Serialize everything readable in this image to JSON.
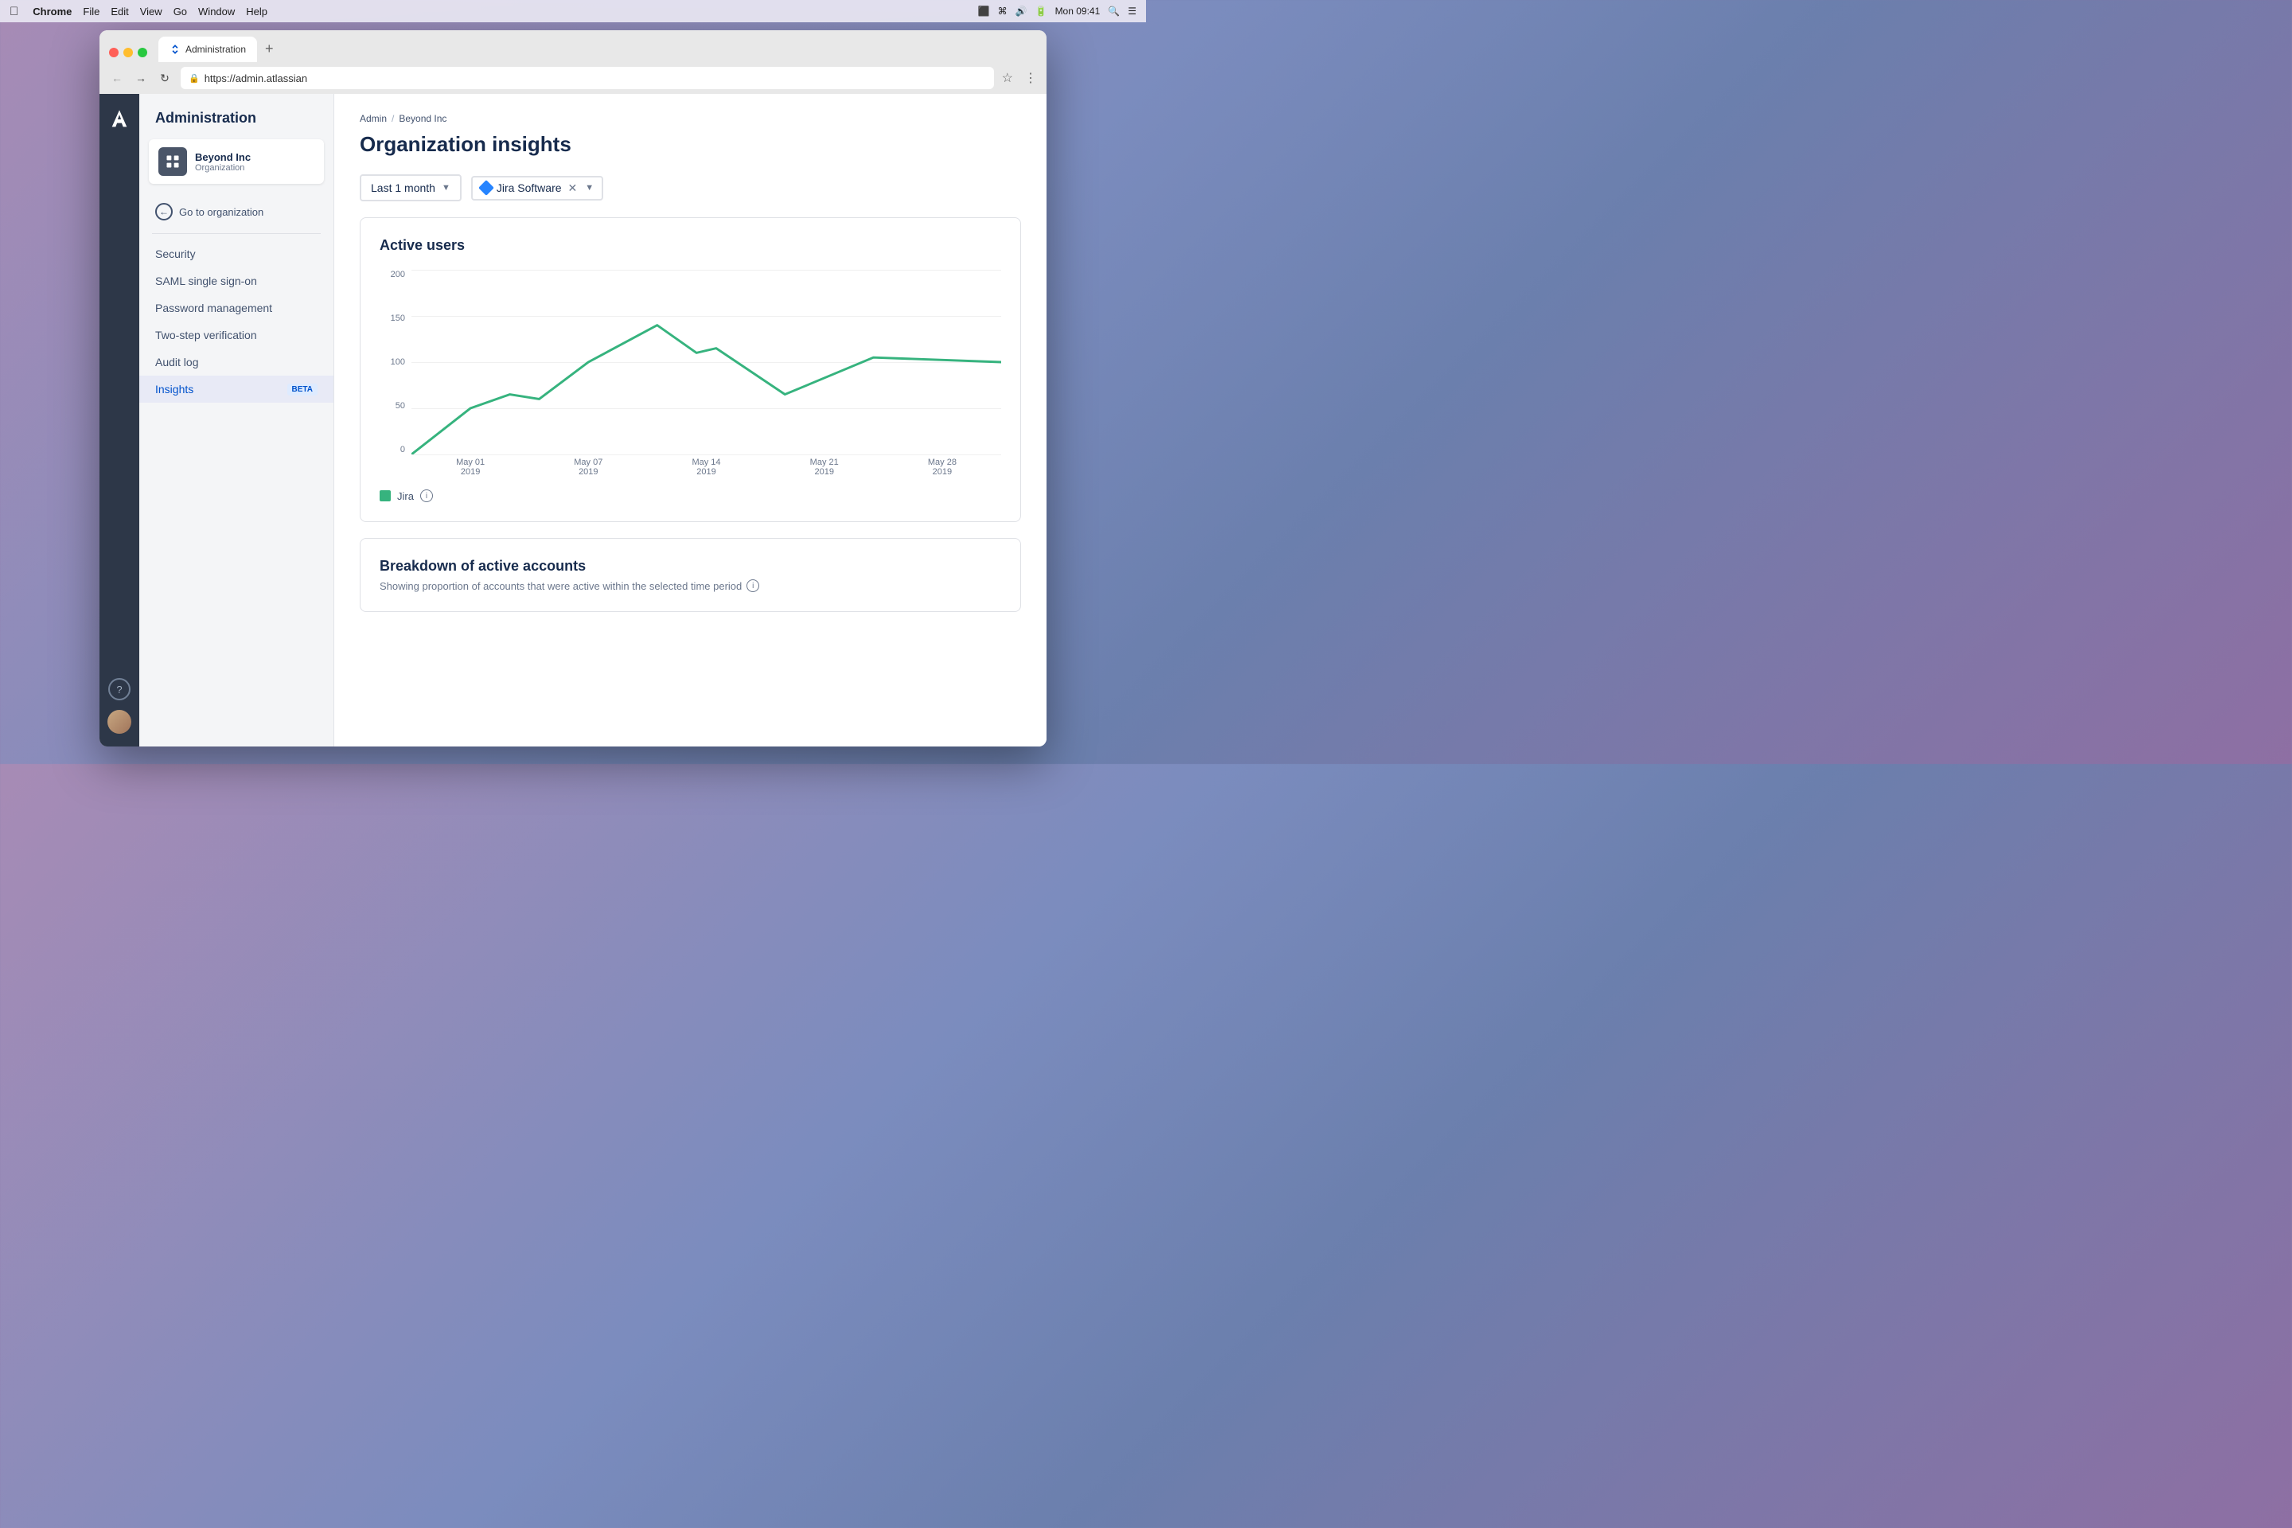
{
  "menubar": {
    "apple": "&#63743;",
    "app": "Chrome",
    "menus": [
      "File",
      "Edit",
      "View",
      "Go",
      "Window",
      "Help"
    ],
    "time": "Mon 09:41"
  },
  "browser": {
    "tab_title": "Administration",
    "url": "https://admin.atlassian",
    "tab_plus": "+"
  },
  "sidebar": {
    "title": "Administration",
    "org_name": "Beyond Inc",
    "org_type": "Organization",
    "go_to_org": "Go to organization",
    "nav_items": [
      {
        "label": "Security",
        "active": false,
        "beta": false
      },
      {
        "label": "SAML single sign-on",
        "active": false,
        "beta": false
      },
      {
        "label": "Password management",
        "active": false,
        "beta": false
      },
      {
        "label": "Two-step verification",
        "active": false,
        "beta": false
      },
      {
        "label": "Audit log",
        "active": false,
        "beta": false
      },
      {
        "label": "Insights",
        "active": true,
        "beta": true
      }
    ]
  },
  "main": {
    "breadcrumb_admin": "Admin",
    "breadcrumb_sep": "/",
    "breadcrumb_org": "Beyond Inc",
    "page_title": "Organization insights",
    "filter_period": "Last 1 month",
    "filter_product": "Jira Software",
    "chart_title": "Active users",
    "y_labels": [
      "200",
      "150",
      "100",
      "50",
      "0"
    ],
    "x_labels": [
      {
        "date": "May 01",
        "year": "2019"
      },
      {
        "date": "May 07",
        "year": "2019"
      },
      {
        "date": "May 14",
        "year": "2019"
      },
      {
        "date": "May 21",
        "year": "2019"
      },
      {
        "date": "May 28",
        "year": "2019"
      }
    ],
    "legend_label": "Jira",
    "breakdown_title": "Breakdown of active accounts",
    "breakdown_subtitle": "Showing proportion of accounts that were active within the selected time period"
  }
}
